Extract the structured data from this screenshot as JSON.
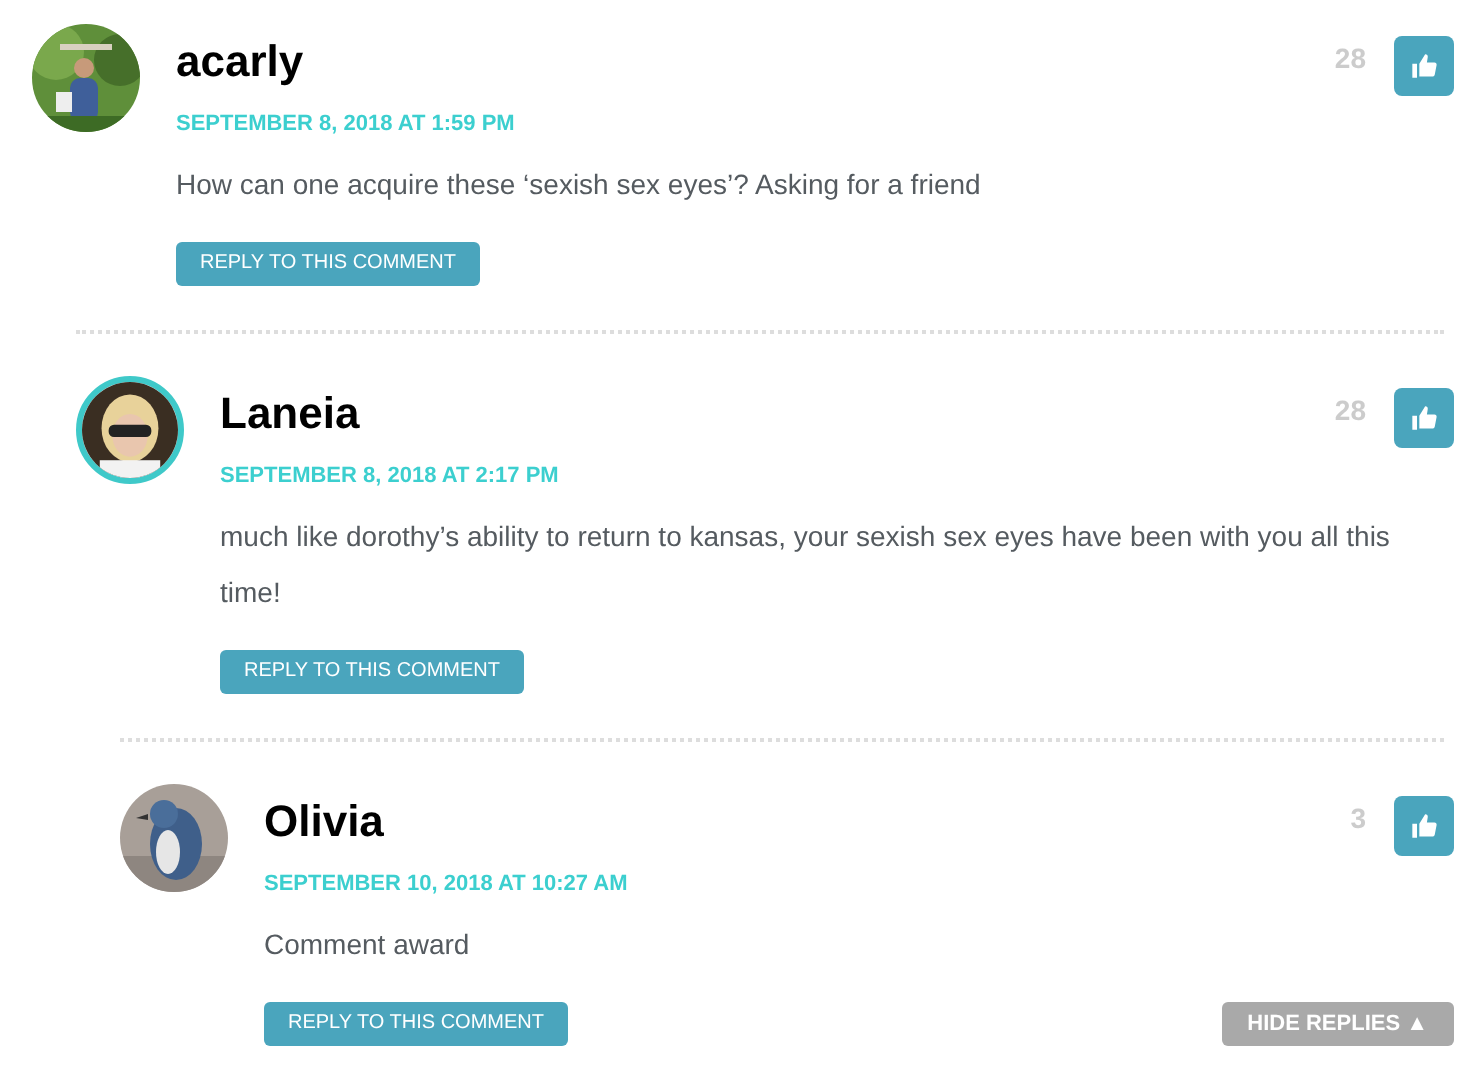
{
  "comments": [
    {
      "name": "acarly",
      "date": "SEPTEMBER 8, 2018 AT 1:59 PM",
      "text": "How can one acquire these ‘sexish sex eyes’? Asking for a friend",
      "likes": "28",
      "reply_button": "REPLY TO THIS COMMENT",
      "highlighted": false,
      "children": [
        {
          "name": "Laneia",
          "date": "SEPTEMBER 8, 2018 AT 2:17 PM",
          "text": "much like dorothy’s ability to return to kansas, your sexish sex eyes have been with you all this time!",
          "likes": "28",
          "reply_button": "REPLY TO THIS COMMENT",
          "highlighted": true,
          "children": [
            {
              "name": "Olivia",
              "date": "SEPTEMBER 10, 2018 AT 10:27 AM",
              "text": "Comment award",
              "likes": "3",
              "reply_button": "REPLY TO THIS COMMENT",
              "highlighted": false
            }
          ]
        }
      ]
    }
  ],
  "hide_replies": "HIDE REPLIES ▲"
}
